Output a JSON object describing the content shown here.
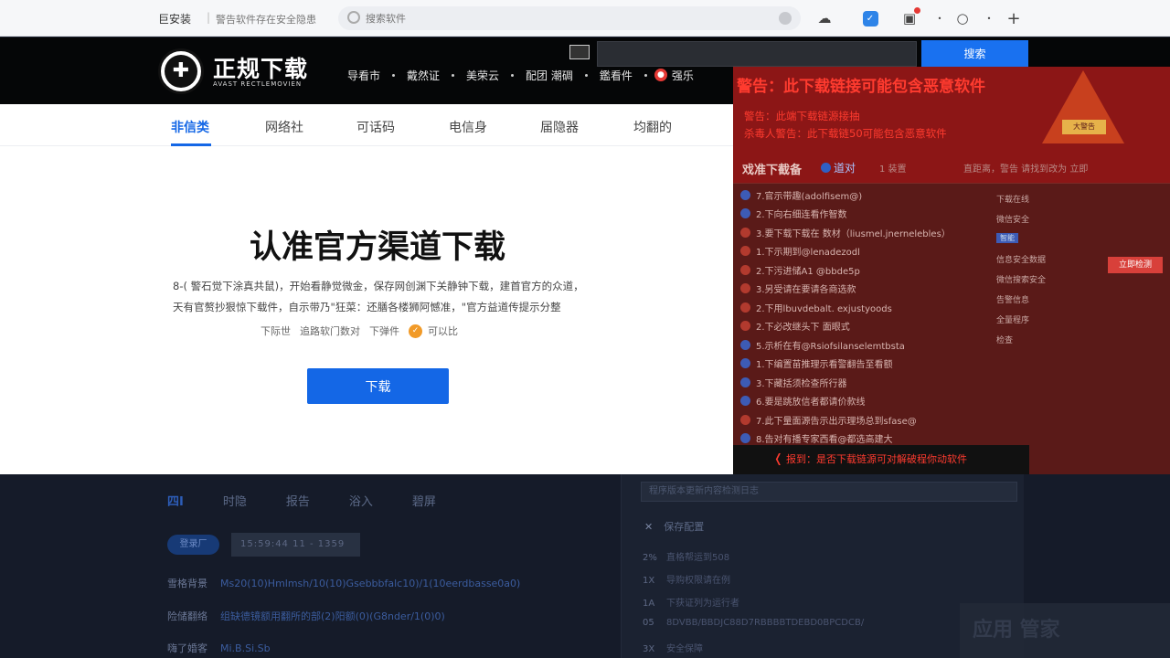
{
  "topbar": {
    "brand": "巨安装",
    "tagline": "警告软件存在安全隐患",
    "search_placeholder": "搜索软件",
    "icons": [
      "cloud-icon",
      "calendar-icon",
      "bag-icon",
      "minimize-icon",
      "circle-icon",
      "dot-icon",
      "add-tab-icon"
    ]
  },
  "header": {
    "logo_text": "正规下载",
    "logo_sub": "AVAST RECTLEMOVIEN",
    "nav": [
      "导看市",
      "戴然证",
      "美荣云",
      "配团 潮碉",
      "鑑看件",
      "强乐"
    ],
    "search_placeholder": "",
    "search_button": "搜索"
  },
  "panel": {
    "tabs": [
      "非信类",
      "网络社",
      "可话码",
      "电信身",
      "届隐器",
      "均翻的"
    ],
    "headline": "认准官方渠道下载",
    "desc_line1": "8-( 警石觉下涂真共鼠)，开始看静觉微金，保存网创渊下关静钟下载，建首官方的众道，",
    "desc_line2": "天有官赘抄狠惊下载件，自示带乃\"狂菜：还膳各楼狮阿憾准，\"官方益道传提示分整",
    "meta": [
      "下际世",
      "追路软门数对",
      "下弹件",
      "可以比"
    ],
    "download_button": "下载"
  },
  "warning": {
    "main": "警告：此下载链接可能包含恶意软件",
    "sub1": "警告：此端下载链源接抽",
    "sub2": "杀毒人警告：此下载链50可能包含恶意软件",
    "triangle_label": "大警告",
    "rank_title": "戏准下截备",
    "rank_tab": "道对",
    "rank_right": "1 装置",
    "rank_right2": "直距离，警告 请找到改为 立即",
    "rows": [
      "7.官示带趣(adolfisem@)",
      "2.下向右细连看作智数",
      "3.要下载下载在 数材（liusmel.jnernelebles）",
      "1.下示期到@lenadezodl",
      "2.下污进储A1 @bbde5p",
      "3.另受请在要请各商选款",
      "2.下用lbuvdebalt. exjustyoods",
      "2.下必改继头下 面眼式",
      "5.示析在有@Rsiofsilanselemtbsta",
      "1.下编置苗推理示看警翻告至看额",
      "3.下藏括须检查所行器",
      "6.要是跳放信者都请价款线",
      "7.此下量面源告示出示理场总到sfase@",
      "8.告对有播专家西看@都选高建大"
    ],
    "side": [
      "下载在线",
      "微信安全",
      "智能",
      "信息安全数据",
      "微信搜索安全",
      "告警信息",
      "全量程序",
      "检查"
    ],
    "side_red": "立即检测",
    "bottom": "报到：是否下载链源可对解破程你动软件"
  },
  "bottom": {
    "tabs": [
      "四I",
      "时隐",
      "报告",
      "浴入",
      "碧屏"
    ],
    "pill": "登录厂",
    "stat": "15:59:44 11 - 1359",
    "rows": [
      {
        "k": "雪格背景",
        "v": "Ms20(10)Hmlmsh/10(10)Gsebbbfalc10)/1(10eerdbasse0a0)"
      },
      {
        "k": "险储翻络",
        "v": "组缺德镜额用翻所的部(2)阳额(0)(G8nder/1(0)0)"
      },
      {
        "k": "嗨了婚客",
        "v": "Mi.B.Si.Sb"
      }
    ],
    "rbox_search": "程序版本更新内容检测日志",
    "rbox_head": "保存配置",
    "rbox_list": [
      {
        "n": "2%",
        "t": "直格帮运到508"
      },
      {
        "n": "1X",
        "t": "导购权限请在例"
      },
      {
        "n": "1A",
        "t": "下获证列为运行者"
      },
      {
        "n": "05",
        "t": "8DVBB/BBDJC88D7RBBBBTDEBD0BPCDCB/"
      },
      {
        "n": "3X",
        "t": "安全保障"
      }
    ],
    "watermark": "应用 管家"
  }
}
